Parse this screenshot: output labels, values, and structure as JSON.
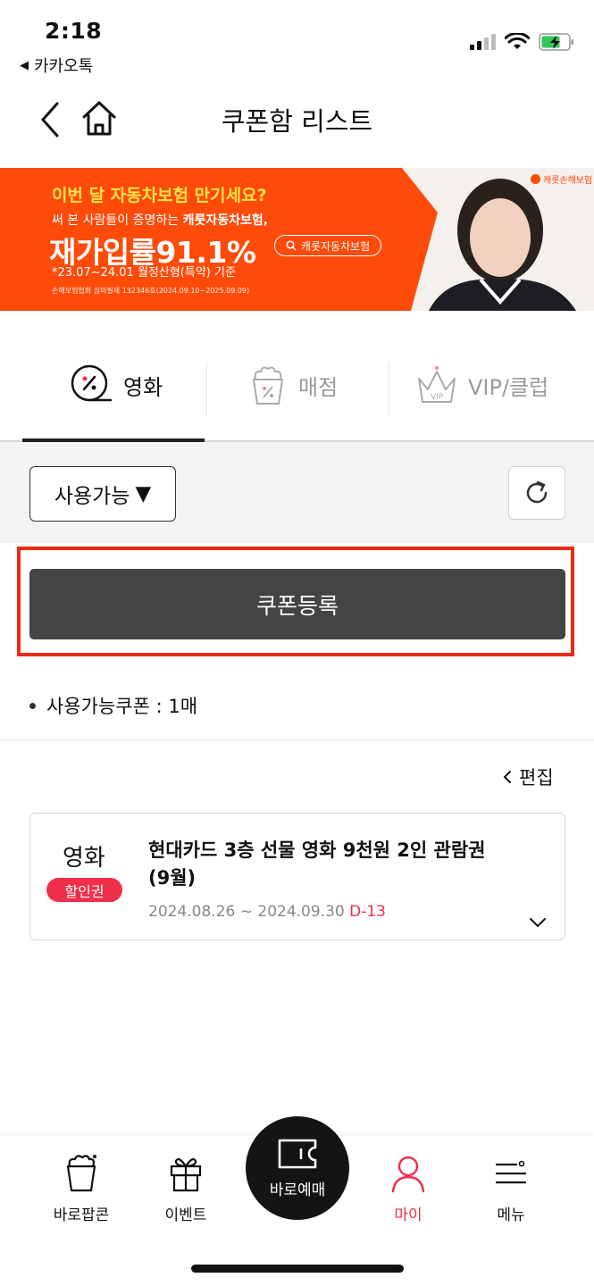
{
  "status_bar": {
    "time": "2:18",
    "back_app": "카카오톡"
  },
  "header": {
    "title": "쿠폰함 리스트"
  },
  "banner": {
    "headline": "이번 달 자동차보험 만기세요?",
    "line2_prefix": "써 본 사람들이 증명하는 ",
    "line2_bold": "캐롯자동차보험,",
    "big_text": "재가입률91.1%",
    "footnote": "*23.07~24.01 월정산형(특약) 기준",
    "tiny": "손해보험협회 심의필제 132346호(2024.09.10~2025.09.09)",
    "search_label": "캐롯자동차보험",
    "brand": "캐롯손해보험",
    "accent_color": "#ff4b0a"
  },
  "tabs": [
    {
      "label": "영화",
      "icon": "movie-discount-icon",
      "active": true
    },
    {
      "label": "매점",
      "icon": "popcorn-icon",
      "active": false
    },
    {
      "label": "VIP/클럽",
      "icon": "crown-icon",
      "active": false
    }
  ],
  "filter": {
    "dropdown_label": "사용가능",
    "dropdown_arrow": "▼",
    "refresh_icon": "refresh-icon"
  },
  "register_button": "쿠폰등록",
  "available_count": "사용가능쿠폰 : 1매",
  "edit_label": "편집",
  "coupon": {
    "type": "영화",
    "badge": "할인권",
    "title": "현대카드 3층 선물 영화 9천원 2인 관람권(9월)",
    "date_range": "2024.08.26 ~ 2024.09.30",
    "d_day": "D-13"
  },
  "bottom_nav": [
    {
      "label": "바로팝콘",
      "icon": "popcorn-bucket-icon",
      "active": false
    },
    {
      "label": "이벤트",
      "icon": "gift-icon",
      "active": false
    },
    {
      "label": "바로예매",
      "icon": "ticket-icon",
      "active": false,
      "center": true
    },
    {
      "label": "마이",
      "icon": "person-icon",
      "active": true
    },
    {
      "label": "메뉴",
      "icon": "menu-icon",
      "active": false
    }
  ],
  "colors": {
    "accent_red": "#ef2f4a",
    "highlight_frame": "#ee2a12",
    "button_dark": "#444444"
  }
}
